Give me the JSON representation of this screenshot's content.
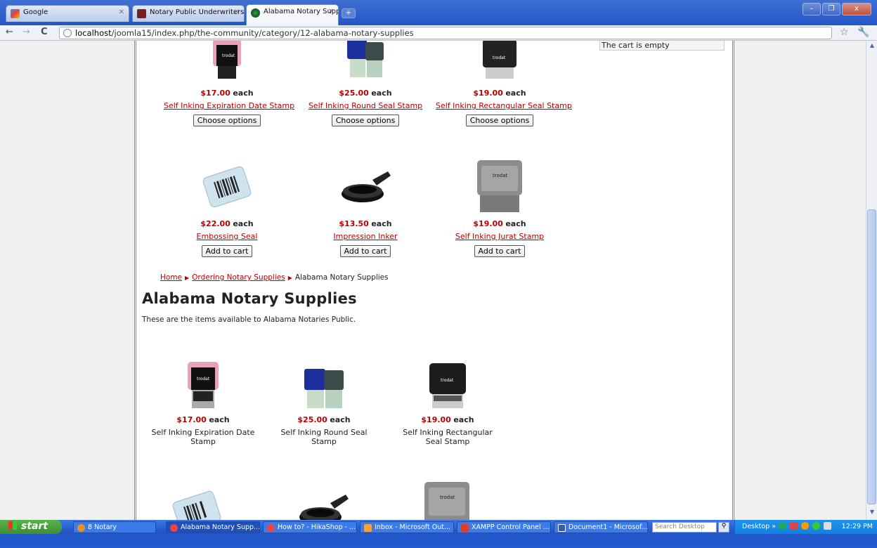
{
  "browser": {
    "tabs": [
      {
        "label": "Google",
        "active": false
      },
      {
        "label": "Notary Public Underwriters, In",
        "active": false
      },
      {
        "label": "Alabama Notary Supplies",
        "active": true
      }
    ],
    "address": {
      "host": "localhost",
      "path": "/joomla15/index.php/the-community/category/12-alabama-notary-supplies"
    }
  },
  "cart": {
    "status": "The cart is empty"
  },
  "top_products": [
    {
      "price": "$17.00",
      "each": "each",
      "name": "Self Inking Expiration Date Stamp",
      "button": "Choose options",
      "img": "pink-stamp"
    },
    {
      "price": "$25.00",
      "each": "each",
      "name": "Self Inking Round Seal Stamp",
      "button": "Choose options",
      "img": "blue-stamp"
    },
    {
      "price": "$19.00",
      "each": "each",
      "name": "Self Inking Rectangular Seal Stamp",
      "button": "Choose options",
      "img": "black-stamp"
    },
    {
      "price": "$22.00",
      "each": "each",
      "name": "Embossing Seal",
      "button": "Add to cart",
      "img": "embosser"
    },
    {
      "price": "$13.50",
      "each": "each",
      "name": "Impression Inker",
      "button": "Add to cart",
      "img": "inker"
    },
    {
      "price": "$19.00",
      "each": "each",
      "name": "Self Inking Jurat Stamp",
      "button": "Add to cart",
      "img": "grey-stamp"
    }
  ],
  "breadcrumb": {
    "home": "Home",
    "parent": "Ordering Notary Supplies",
    "current": "Alabama Notary Supplies"
  },
  "category": {
    "title": "Alabama Notary Supplies",
    "description": "These are the items available to Alabama Notaries Public."
  },
  "bottom_products": [
    {
      "price": "$17.00",
      "each": "each",
      "name": "Self Inking Expiration Date Stamp",
      "img": "pink-stamp"
    },
    {
      "price": "$25.00",
      "each": "each",
      "name": "Self Inking Round Seal Stamp",
      "img": "blue-stamp"
    },
    {
      "price": "$19.00",
      "each": "each",
      "name": "Self Inking Rectangular Seal Stamp",
      "img": "black-stamp"
    }
  ],
  "taskbar": {
    "start": "start",
    "tasks": [
      {
        "label": "8 Notary"
      },
      {
        "label": "Alabama Notary Supp..."
      },
      {
        "label": "How to? - HikaShop - ..."
      },
      {
        "label": "Inbox - Microsoft Out..."
      },
      {
        "label": "XAMPP Control Panel ..."
      },
      {
        "label": "Document1 - Microsof..."
      }
    ],
    "search_placeholder": "Search Desktop",
    "desktop": "Desktop",
    "clock": "12:29 PM"
  },
  "colors": {
    "link": "#bb0000",
    "price": "#bb0000"
  }
}
